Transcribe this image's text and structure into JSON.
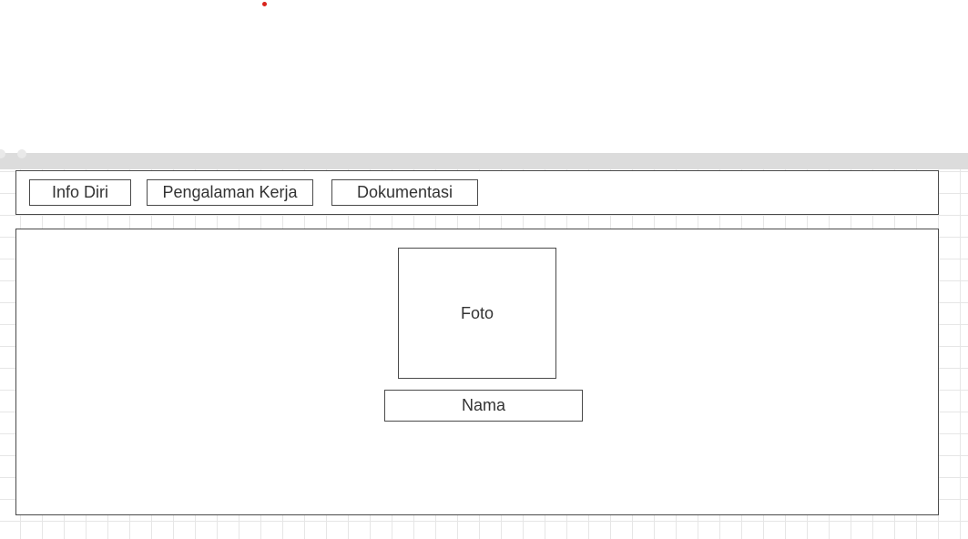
{
  "tabs": [
    {
      "label": "Info Diri"
    },
    {
      "label": "Pengalaman Kerja"
    },
    {
      "label": "Dokumentasi"
    }
  ],
  "profile": {
    "photo_label": "Foto",
    "name_label": "Nama"
  },
  "colors": {
    "border": "#4a4a4a",
    "text": "#333333",
    "top_bar": "#dcdcdc",
    "grid": "#e6e6e6",
    "marker": "#d9241c"
  }
}
